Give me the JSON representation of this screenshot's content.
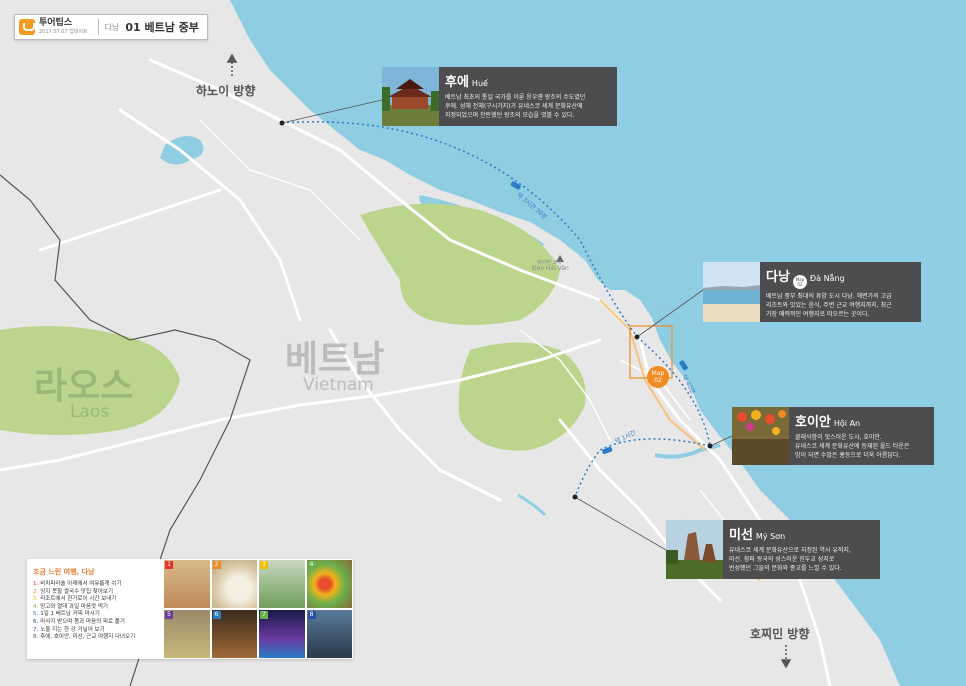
{
  "header": {
    "brand_name": "투어팁스",
    "brand_date": "2017.07.07 업데이트",
    "city": "다낭",
    "title": "01 베트남 중부"
  },
  "map_labels": {
    "vietnam_kr": "베트남",
    "vietnam_en": "Vietnam",
    "laos_kr": "라오스",
    "laos_en": "Laos",
    "hanoi_direction": "하노이 방향",
    "hcmc_direction": "호찌민 방향",
    "pass_kr": "하이번 고개",
    "pass_en": "Đèo Hải Vân"
  },
  "routes": [
    {
      "label": "약 3시간 30분"
    },
    {
      "label": "약 40분"
    },
    {
      "label": "약 1시간"
    }
  ],
  "map_marker": {
    "line1": "Map",
    "line2": "02"
  },
  "cards": {
    "hue": {
      "name": "후에",
      "latin": "Huế",
      "desc": [
        "베트남 최초의 통일 국가를 이룬 응우옌 왕조의 수도였던",
        "후에. 성채 전체(구시가지)가 유네스코 세계 문화유산에",
        "지정되었으며 찬란했던 왕조의 모습을 엿볼 수 있다."
      ]
    },
    "danang": {
      "name": "다낭",
      "badge_line1": "Map",
      "badge_line2": "02",
      "latin": "Đà Nẵng",
      "desc": [
        "베트남 중부 최대의 휴양 도시 다낭. 해변가의 고급",
        "리조트와 맛있는 음식, 주변 근교 여행지까지, 최근",
        "가장 매력적인 여행지로 떠오르는 곳이다."
      ]
    },
    "hoian": {
      "name": "호이안",
      "latin": "Hội An",
      "desc": [
        "클래식함이 멋스러운 도시, 호이안.",
        "유네스코 세계 문화유산에 등재된 올드 타운은",
        "밤이 되면 수많은 홍등으로 더욱 아름답다."
      ]
    },
    "myson": {
      "name": "미선",
      "latin": "Mỹ Sơn",
      "desc": [
        "유네스코 세계 문화유산으로 지정된 역사 유적지,",
        "미선. 참파 왕국의 성스러운 힌두교 성지로",
        "번성했던 그들의 문화와 종교를 느낄 수 있다."
      ]
    }
  },
  "tips": {
    "title": "조금 느린 여행, 다낭",
    "items": [
      {
        "num": "1.",
        "text": "비치파라솔 아래에서 여유롭게 쉬기"
      },
      {
        "num": "2.",
        "text": "잉지 못할 쌀국수 맛집 찾아보기"
      },
      {
        "num": "3.",
        "text": "리조트에서 한가로이 시간 보내기"
      },
      {
        "num": "4.",
        "text": "망고와 열대 과일 마음껏 먹기"
      },
      {
        "num": "5.",
        "text": "1일 1 베트남 커피 마시기"
      },
      {
        "num": "6.",
        "text": "마사지 받으며 몸과 마음의 피로 풀기"
      },
      {
        "num": "7.",
        "text": "노을 지는 한 강 거닐어 보기"
      },
      {
        "num": "8.",
        "text": "후에, 호이안, 미선, 근교 여행지 다녀오기"
      }
    ],
    "photo_numbers": [
      "1",
      "2",
      "3",
      "4",
      "5",
      "6",
      "7",
      "8"
    ]
  },
  "colors": {
    "sea": "#8fcde3",
    "land": "#e7e7e7",
    "forest": "#bcd58d",
    "road": "#ffffff",
    "highlight_road": "#f6c27a",
    "route": "#2a7cc6",
    "accent": "#f08a23",
    "card_bg": "#4d4d4f",
    "tip_numbers": [
      "#e8332a",
      "#f08a23",
      "#f0c000",
      "#6ab04c",
      "#2a7cc6",
      "#2a4f9e",
      "#6e3b9e",
      "#555555"
    ]
  }
}
